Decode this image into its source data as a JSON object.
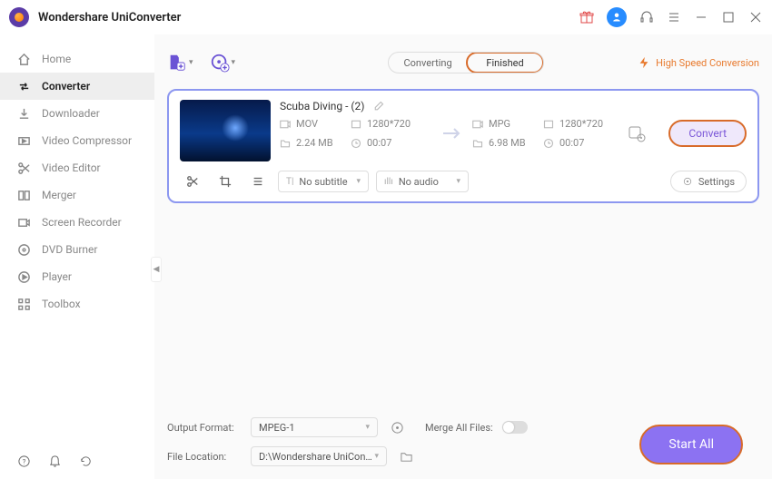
{
  "app": {
    "title": "Wondershare UniConverter"
  },
  "sidebar": {
    "items": [
      {
        "label": "Home"
      },
      {
        "label": "Converter"
      },
      {
        "label": "Downloader"
      },
      {
        "label": "Video Compressor"
      },
      {
        "label": "Video Editor"
      },
      {
        "label": "Merger"
      },
      {
        "label": "Screen Recorder"
      },
      {
        "label": "DVD Burner"
      },
      {
        "label": "Player"
      },
      {
        "label": "Toolbox"
      }
    ]
  },
  "tabs": {
    "converting": "Converting",
    "finished": "Finished"
  },
  "highspeed": "High Speed Conversion",
  "file": {
    "title": "Scuba Diving - (2)",
    "src": {
      "fmt": "MOV",
      "res": "1280*720",
      "size": "2.24 MB",
      "dur": "00:07"
    },
    "dst": {
      "fmt": "MPG",
      "res": "1280*720",
      "size": "6.98 MB",
      "dur": "00:07"
    },
    "convert_label": "Convert",
    "subtitle": "No subtitle",
    "audio": "No audio",
    "settings": "Settings"
  },
  "footer": {
    "output_format_label": "Output Format:",
    "output_format_value": "MPEG-1",
    "file_location_label": "File Location:",
    "file_location_value": "D:\\Wondershare UniConverter",
    "merge_label": "Merge All Files:",
    "start_all": "Start All"
  }
}
